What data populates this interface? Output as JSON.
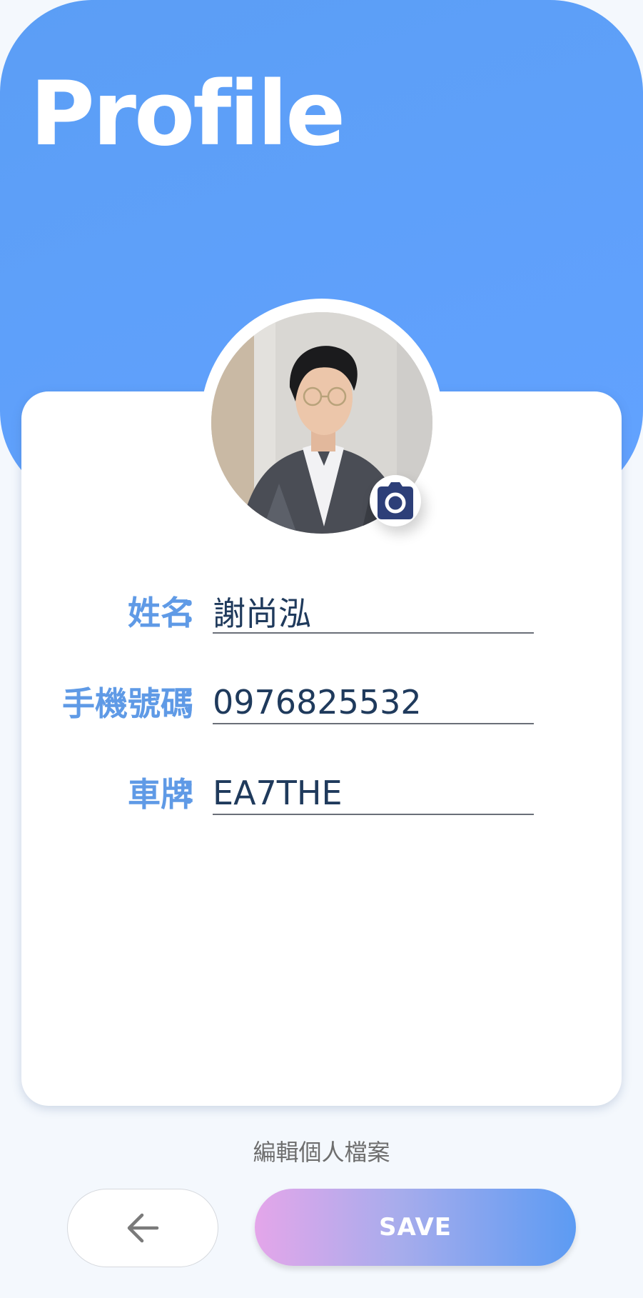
{
  "header": {
    "title": "Profile"
  },
  "profile": {
    "avatar_icon": "user-photo",
    "camera_icon": "camera-icon"
  },
  "fields": [
    {
      "label": "姓名",
      "colon": "：",
      "value": "謝尚泓"
    },
    {
      "label": "手機號碼",
      "colon": "：",
      "value": "0976825532"
    },
    {
      "label": "車牌",
      "colon": "：",
      "value": "EA7THE"
    }
  ],
  "footer": {
    "caption": "編輯個人檔案",
    "back_icon": "arrow-left-icon",
    "save_label": "SAVE"
  },
  "colors": {
    "header_blue": "#5b9ef5",
    "label_blue": "#5f9ae6",
    "value_navy": "#1f3a5c",
    "camera_navy": "#2d3f78",
    "save_gradient_start": "#e4a6ea",
    "save_gradient_end": "#5c9bf3"
  }
}
